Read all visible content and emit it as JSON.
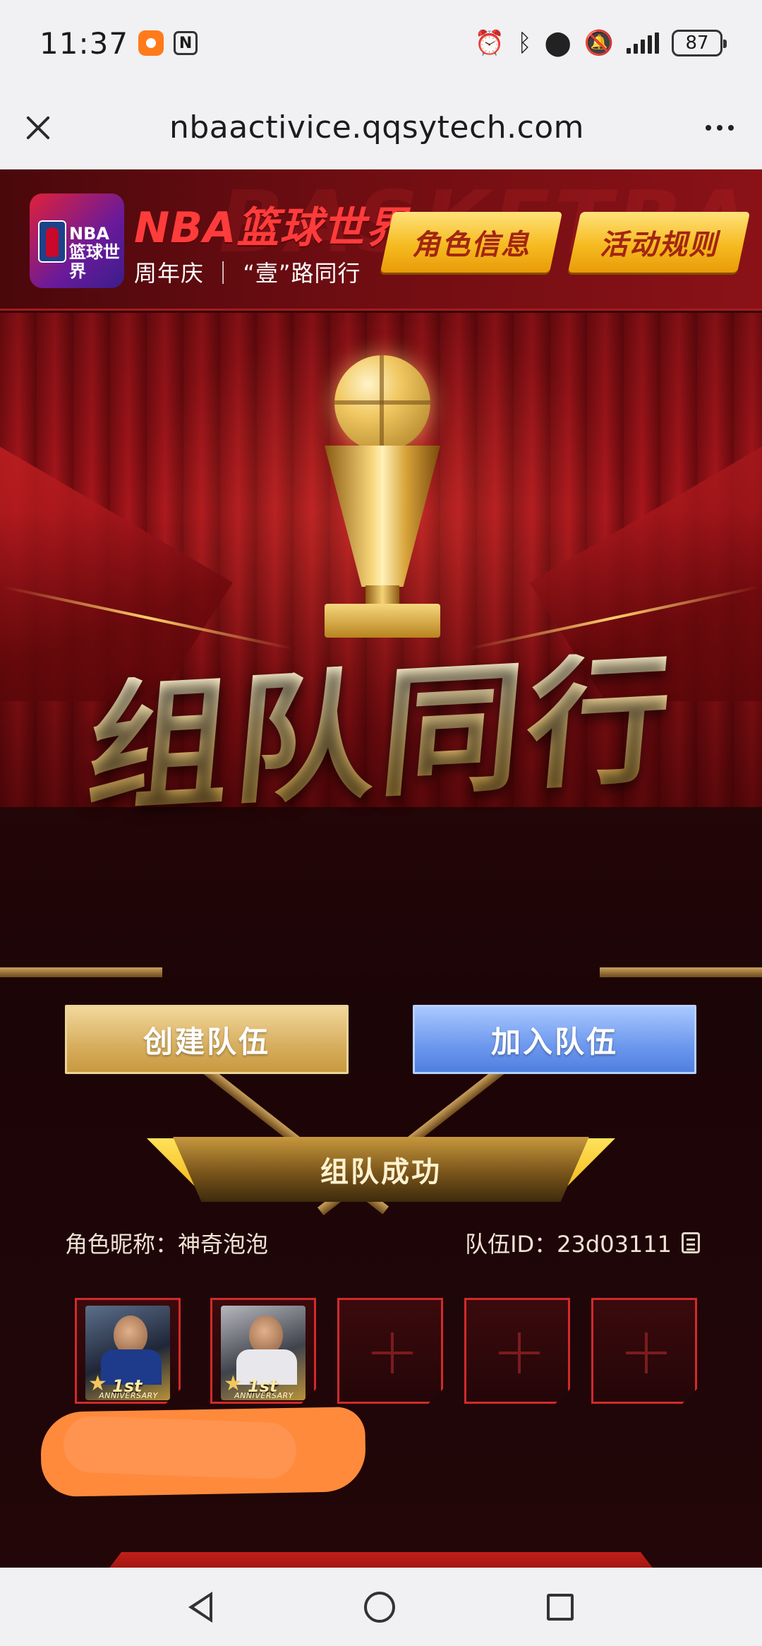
{
  "status_bar": {
    "time": "11:37",
    "battery": "87",
    "icons": [
      "app-icon",
      "nfc-icon",
      "alarm-icon",
      "bluetooth-icon",
      "location-icon",
      "mute-icon",
      "signal-icon",
      "battery-icon"
    ]
  },
  "browser": {
    "url": "nbaactivice.qqsytech.com",
    "close_icon": "close-icon",
    "more_icon": "more-icon"
  },
  "header": {
    "logo_text_line1": "NBA",
    "logo_text_line2": "篮球世界",
    "brand_title": "NBA篮球世界",
    "brand_subtitle": "周年庆 ｜ “壹”路同行",
    "watermark": "BASKETBA",
    "role_info_button": "角色信息",
    "rules_button": "活动规则"
  },
  "hero": {
    "title_art": "组队同行"
  },
  "actions": {
    "create_team": "创建队伍",
    "join_team": "加入队伍"
  },
  "team": {
    "status_banner": "组队成功",
    "nickname_label": "角色昵称：",
    "nickname_value": "神奇泡泡",
    "team_id_label": "队伍ID：",
    "team_id_value": "23d03111",
    "slots": [
      {
        "state": "filled",
        "badge": "1st",
        "badge_sub": "ANNIVERSARY"
      },
      {
        "state": "filled",
        "badge": "1st",
        "badge_sub": "ANNIVERSARY"
      },
      {
        "state": "empty"
      },
      {
        "state": "empty"
      },
      {
        "state": "empty"
      }
    ]
  },
  "colors": {
    "accent_gold": "#f6bb21",
    "accent_red": "#d22a2a",
    "join_blue": "#6d98ee",
    "redaction_orange": "#ff8a3c"
  }
}
